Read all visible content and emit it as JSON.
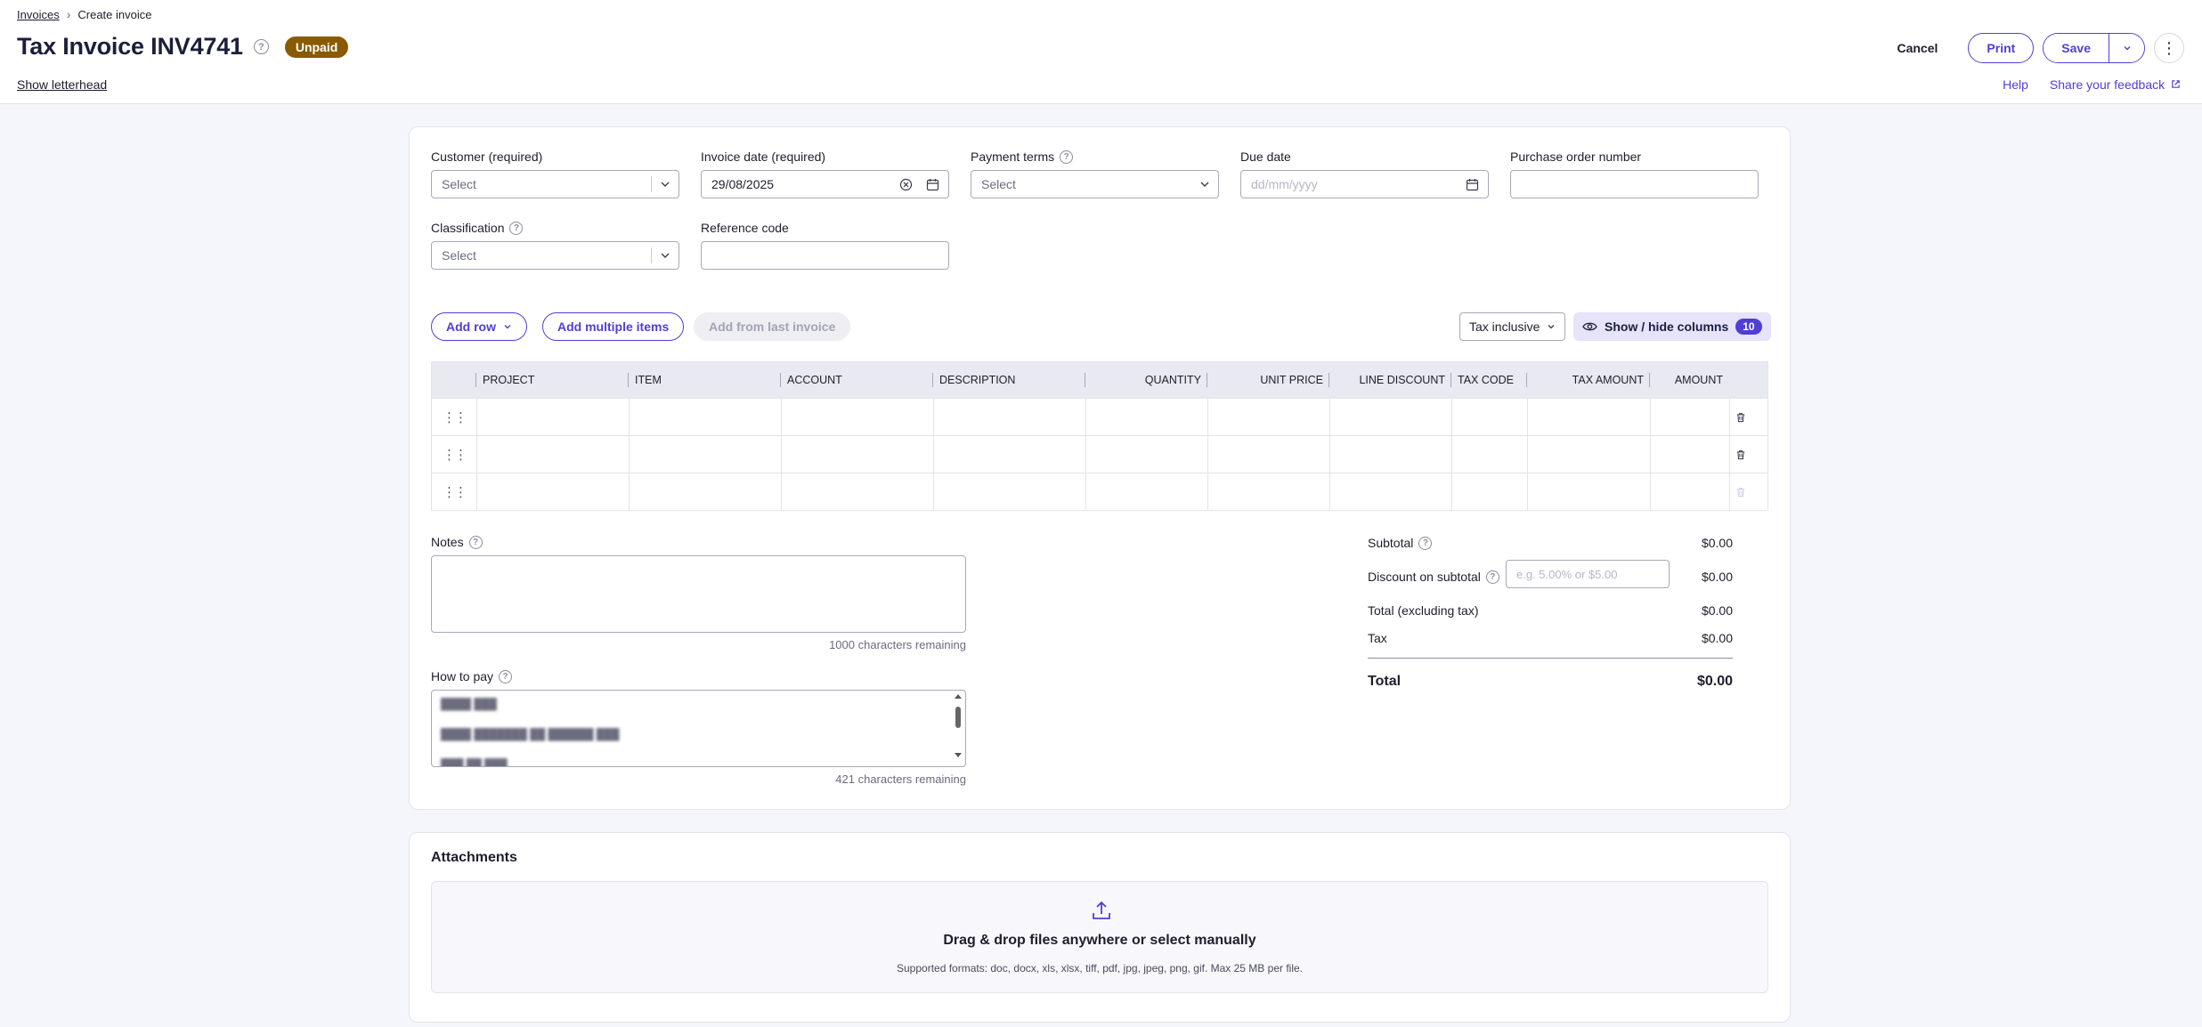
{
  "breadcrumb": {
    "parent": "Invoices",
    "current": "Create invoice"
  },
  "header": {
    "title": "Tax Invoice INV4741",
    "status_badge": "Unpaid",
    "show_letterhead": "Show letterhead",
    "cancel_label": "Cancel",
    "print_label": "Print",
    "save_label": "Save",
    "help_link": "Help",
    "feedback_link": "Share your feedback"
  },
  "form": {
    "customer": {
      "label": "Customer (required)",
      "placeholder": "Select"
    },
    "invoice_date": {
      "label": "Invoice date (required)",
      "value": "29/08/2025"
    },
    "payment_terms": {
      "label": "Payment terms",
      "placeholder": "Select"
    },
    "due_date": {
      "label": "Due date",
      "placeholder": "dd/mm/yyyy"
    },
    "po_number": {
      "label": "Purchase order number",
      "value": ""
    },
    "classification": {
      "label": "Classification",
      "placeholder": "Select"
    },
    "reference_code": {
      "label": "Reference code",
      "value": ""
    }
  },
  "toolbar": {
    "add_row": "Add row",
    "add_multiple": "Add multiple items",
    "add_from_last": "Add from last invoice",
    "tax_mode": "Tax inclusive",
    "show_hide": "Show / hide columns",
    "column_count": "10"
  },
  "table": {
    "columns": [
      "PROJECT",
      "ITEM",
      "ACCOUNT",
      "DESCRIPTION",
      "QUANTITY",
      "UNIT PRICE",
      "LINE DISCOUNT",
      "TAX CODE",
      "TAX AMOUNT",
      "AMOUNT"
    ],
    "row_count": 3
  },
  "notes": {
    "label": "Notes",
    "remaining": "1000 characters remaining"
  },
  "how_to_pay": {
    "label": "How to pay",
    "remaining": "421 characters remaining"
  },
  "totals": {
    "subtotal_label": "Subtotal",
    "subtotal": "$0.00",
    "discount_label": "Discount on subtotal",
    "discount_placeholder": "e.g. 5.00% or $5.00",
    "discount": "$0.00",
    "total_ex_tax_label": "Total (excluding tax)",
    "total_ex_tax": "$0.00",
    "tax_label": "Tax",
    "tax": "$0.00",
    "total_label": "Total",
    "total": "$0.00"
  },
  "attachments": {
    "title": "Attachments",
    "drop_title": "Drag & drop files anywhere or select manually",
    "formats": "Supported formats: doc, docx, xls, xlsx, tiff, pdf, jpg, jpeg, png, gif. Max 25 MB per file."
  },
  "colors": {
    "accent": "#4f3fd4",
    "badge_unpaid": "#8a5a00",
    "title": "#1b1f3b"
  },
  "icons": [
    "help-icon",
    "chevron-right-icon",
    "chevron-down-icon",
    "calendar-icon",
    "clear-icon",
    "eye-icon",
    "drag-handle-icon",
    "trash-icon",
    "upload-icon",
    "external-link-icon",
    "more-vertical-icon"
  ]
}
